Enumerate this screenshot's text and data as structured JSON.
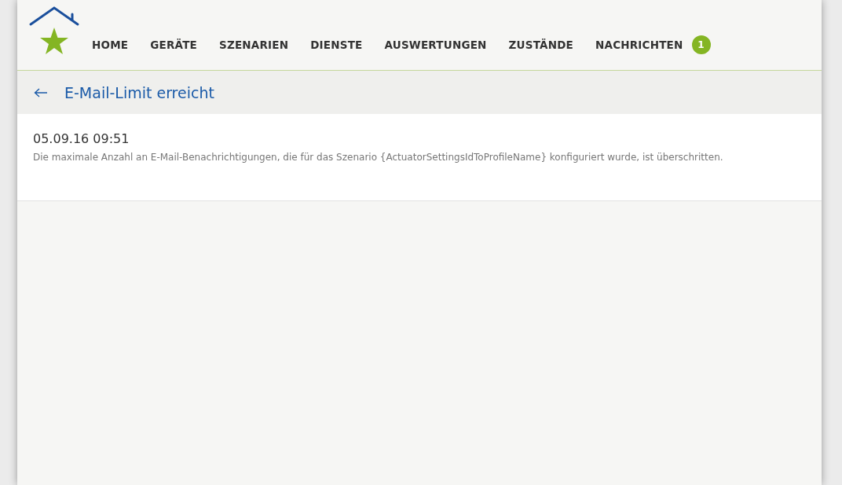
{
  "nav": {
    "items": [
      {
        "label": "HOME"
      },
      {
        "label": "GERÄTE"
      },
      {
        "label": "SZENARIEN"
      },
      {
        "label": "DIENSTE"
      },
      {
        "label": "AUSWERTUNGEN"
      },
      {
        "label": "ZUSTÄNDE"
      },
      {
        "label": "NACHRICHTEN",
        "badge": "1"
      }
    ]
  },
  "header": {
    "title": "E-Mail-Limit erreicht"
  },
  "message": {
    "timestamp": "05.09.16 09:51",
    "text": "Die maximale Anzahl an E-Mail-Benachrichtigungen, die für das Szenario {ActuatorSettingsIdToProfileName} konfiguriert wurde, ist überschritten."
  }
}
